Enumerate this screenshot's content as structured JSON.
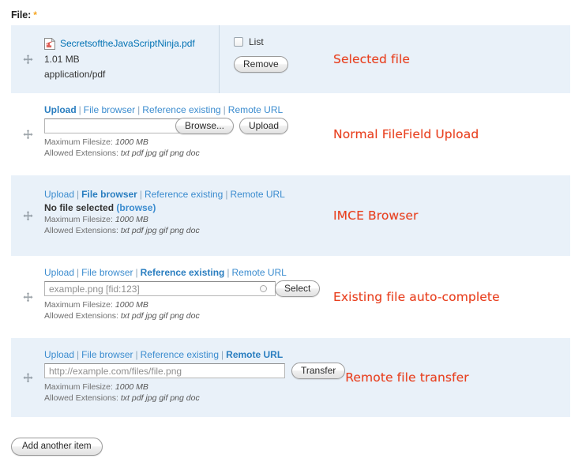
{
  "form": {
    "field_label": "File:",
    "required_marker": "*",
    "add_another_label": "Add another item",
    "drag_handle_icon": "move-cross-icon"
  },
  "tabs": {
    "upload": "Upload",
    "file_browser": "File browser",
    "reference_existing": "Reference existing",
    "remote_url": "Remote URL",
    "separator": "|"
  },
  "descriptions": {
    "max_filesize_label": "Maximum Filesize:",
    "max_filesize_value": "1000 MB",
    "allowed_extensions_label": "Allowed Extensions:",
    "allowed_extensions_value": "txt pdf jpg gif png doc"
  },
  "panels": [
    {
      "id": "selected-file",
      "background": "#e9f1f9",
      "annotation": "Selected file",
      "file": {
        "icon": "pdf-file-icon",
        "name": "SecretsoftheJavaScriptNinja.pdf",
        "size": "1.01 MB",
        "mime": "application/pdf"
      },
      "list_checkbox_label": "List",
      "list_checkbox_checked": false,
      "remove_label": "Remove"
    },
    {
      "id": "normal-filefield-upload",
      "background": "#ffffff",
      "annotation": "Normal FileField Upload",
      "active_tab": "Upload",
      "input_value": "",
      "input_placeholder": "",
      "browse_label": "Browse...",
      "upload_label": "Upload"
    },
    {
      "id": "imce-browser",
      "background": "#e9f1f9",
      "annotation": "IMCE Browser",
      "active_tab": "File browser",
      "no_file_text": "No file selected",
      "browse_link": "(browse)"
    },
    {
      "id": "existing-file-autocomplete",
      "background": "#ffffff",
      "annotation": "Existing file auto-complete",
      "active_tab": "Reference existing",
      "input_value": "example.png [fid:123]",
      "throbber_icon": "autocomplete-throbber-icon",
      "select_label": "Select"
    },
    {
      "id": "remote-file-transfer",
      "background": "#e9f1f9",
      "annotation": "Remote file transfer",
      "active_tab": "Remote URL",
      "input_value": "http://example.com/files/file.png",
      "transfer_label": "Transfer"
    }
  ],
  "colors": {
    "panel_blue": "#e9f1f9",
    "annotation_red": "#e8401f",
    "link_blue": "#3b8ccf",
    "file_link_blue": "#0071b3",
    "required_orange": "#f5a623"
  }
}
